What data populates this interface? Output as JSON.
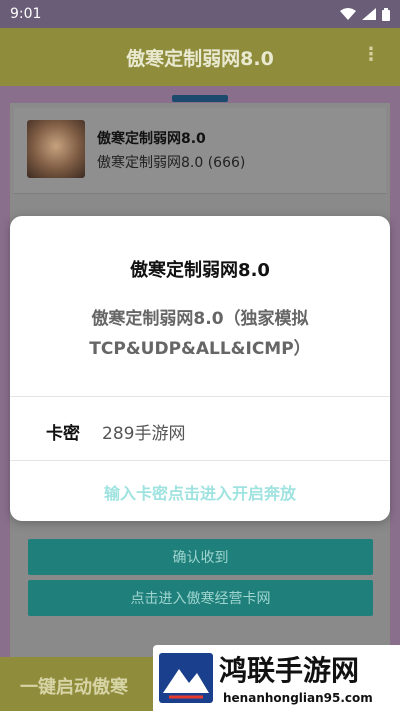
{
  "status_bar": {
    "time": "9:01"
  },
  "app": {
    "title": "傲寒定制弱网8.0",
    "card_title": "傲寒定制弱网8.0",
    "card_subtitle": "傲寒定制弱网8.0 (666)",
    "buttons": [
      "确认收到",
      "点击进入傲寒经营卡网"
    ],
    "bottom_text": "一键启动傲寒"
  },
  "dialog": {
    "title": "傲寒定制弱网8.0",
    "subtitle": "傲寒定制弱网8.0（独家模拟TCP&UDP&ALL&ICMP）",
    "field_label": "卡密",
    "field_value": "289手游网",
    "action": "输入卡密点击进入开启奔放"
  },
  "watermark": {
    "brand": "鸿联手游网",
    "url": "henanhonglian95.com"
  },
  "colors": {
    "teal": "#1f7f7a",
    "olive": "#8f8c3c",
    "accent": "#9fe3e0"
  }
}
